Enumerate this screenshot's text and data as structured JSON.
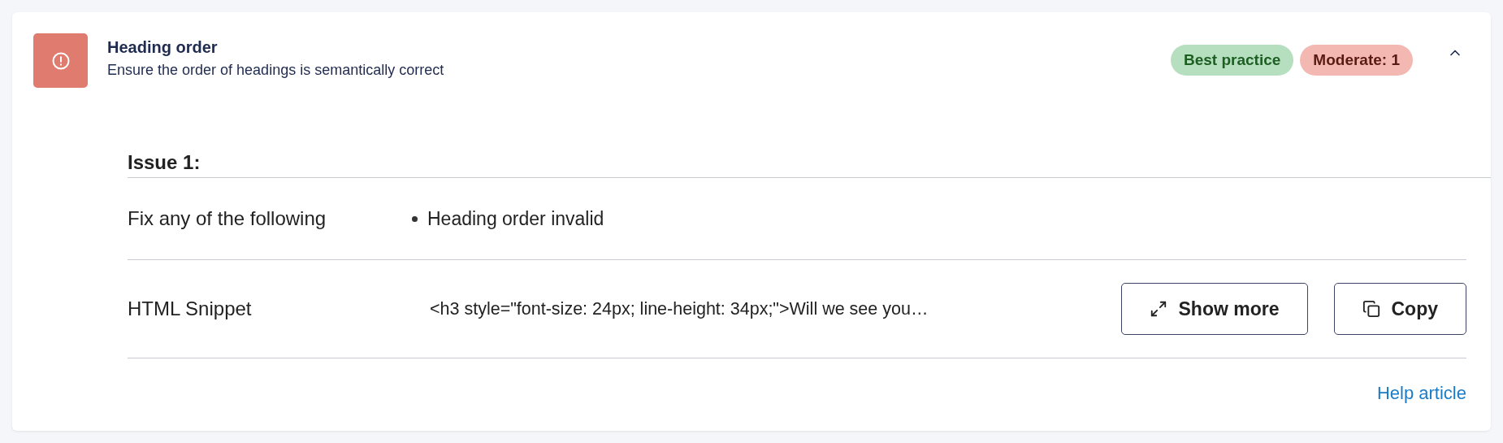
{
  "rule": {
    "title": "Heading order",
    "description": "Ensure the order of headings is semantically correct",
    "expanded": true,
    "tags": [
      {
        "label": "Best practice",
        "kind": "category"
      },
      {
        "label": "Moderate: 1",
        "kind": "impact"
      }
    ]
  },
  "issue": {
    "title": "Issue 1:",
    "fix_label": "Fix any of the following",
    "fixes": [
      "Heading order invalid"
    ],
    "snippet_label": "HTML Snippet",
    "snippet": "<h3 style=\"font-size: 24px; line-height: 34px;\">Will we see you…",
    "buttons": [
      {
        "label": "Show more",
        "kind": "expand"
      },
      {
        "label": "Copy",
        "kind": "copy"
      }
    ]
  },
  "help_link": "Help article"
}
